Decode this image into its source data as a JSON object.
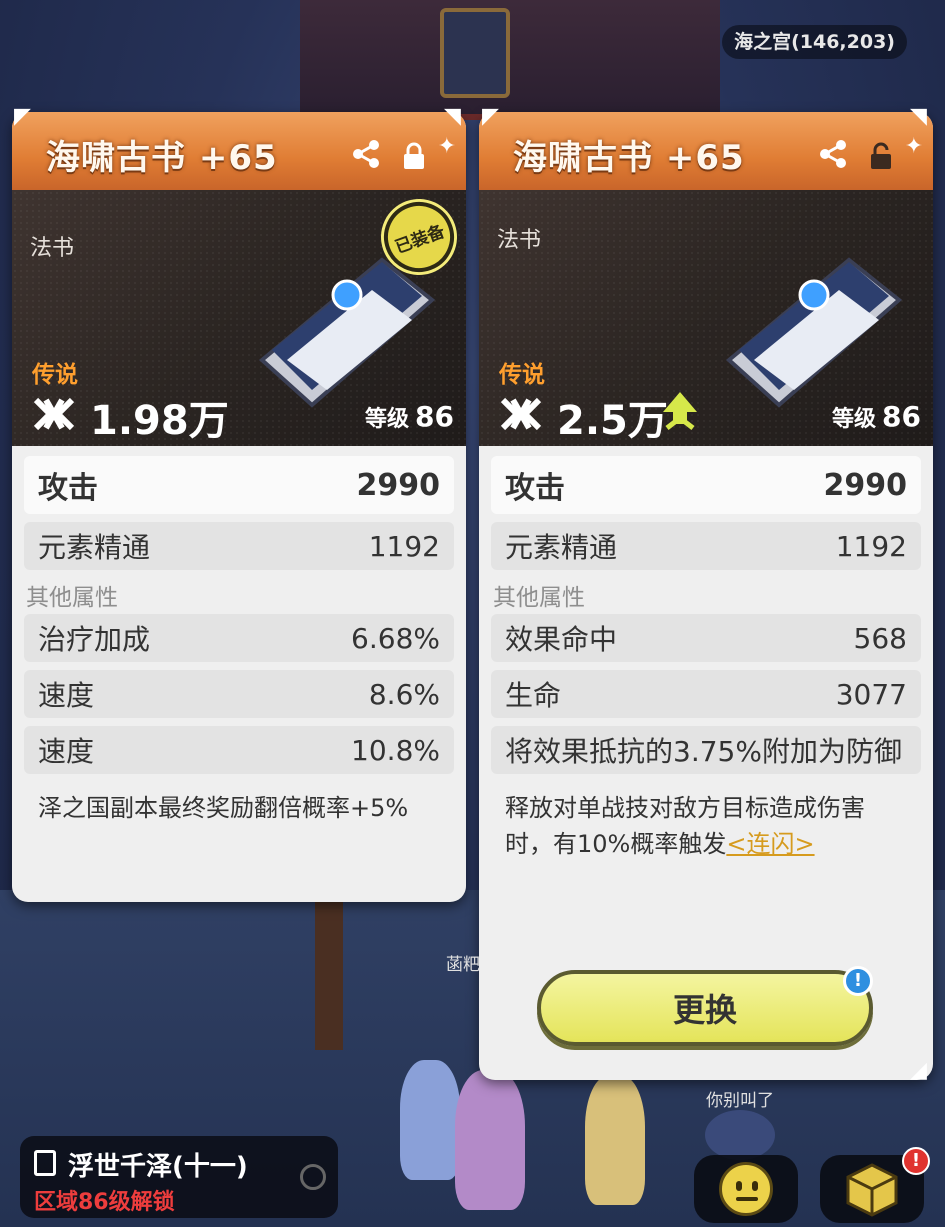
{
  "location": "海之宫(146,203)",
  "left_card": {
    "title": "海啸古书 +65",
    "category": "法书",
    "equipped_badge": "已装备",
    "rarity": "传说",
    "power": "1.98万",
    "level_label": "等级",
    "level": "86",
    "main_stats": [
      {
        "name": "攻击",
        "value": "2990"
      },
      {
        "name": "元素精通",
        "value": "1192"
      }
    ],
    "other_label": "其他属性",
    "sub_stats": [
      {
        "name": "治疗加成",
        "value": "6.68%"
      },
      {
        "name": "速度",
        "value": "8.6%"
      },
      {
        "name": "速度",
        "value": "10.8%"
      }
    ],
    "description": "泽之国副本最终奖励翻倍概率+5%"
  },
  "right_card": {
    "title": "海啸古书 +65",
    "category": "法书",
    "rarity": "传说",
    "power": "2.5万",
    "level_label": "等级",
    "level": "86",
    "main_stats": [
      {
        "name": "攻击",
        "value": "2990"
      },
      {
        "name": "元素精通",
        "value": "1192"
      }
    ],
    "other_label": "其他属性",
    "sub_stats": [
      {
        "name": "效果命中",
        "value": "568"
      },
      {
        "name": "生命",
        "value": "3077"
      }
    ],
    "special": "将效果抵抗的3.75%附加为防御",
    "description_prefix": "释放对单战技对敌方目标造成伤害时，有10%概率触发",
    "description_link": "<连闪>",
    "button_label": "更换",
    "button_badge": "!"
  },
  "quest": {
    "title": "浮世千泽(十一)",
    "subtitle": "区域86级解锁"
  },
  "npc_label": "你别叫了",
  "npc_label2": "菡粑",
  "notify_badge": "!",
  "colors": {
    "header_orange": "#e07d34",
    "rarity_orange": "#ff9f2e",
    "unlock_red": "#ee3d3d",
    "link_gold": "#d69b1e",
    "button_yellow": "#e4e45a"
  }
}
